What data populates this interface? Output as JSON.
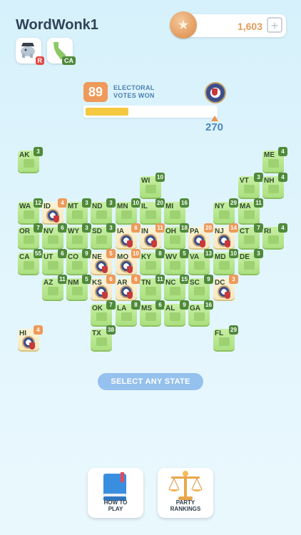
{
  "header": {
    "username": "WordWonk1",
    "coins": "1,603",
    "plus": "+",
    "coin_symbol": "★",
    "badges": [
      {
        "label": "R",
        "color": "#e04a46",
        "icon": "republican-elephant-icon"
      },
      {
        "label": "CA",
        "color": "#4f8a3a",
        "icon": "california-map-icon"
      }
    ]
  },
  "electoral": {
    "votes_won": "89",
    "label_line1": "ELECTORAL",
    "label_line2": "VOTES WON",
    "goal": "270",
    "progress_fraction": 0.33
  },
  "states": [
    {
      "code": "AK",
      "ev": "3",
      "won": false
    },
    {
      "code": "ME",
      "ev": "4",
      "won": false
    },
    {
      "code": "WI",
      "ev": "10",
      "won": false
    },
    {
      "code": "VT",
      "ev": "3",
      "won": false
    },
    {
      "code": "NH",
      "ev": "4",
      "won": false
    },
    {
      "code": "WA",
      "ev": "12",
      "won": false
    },
    {
      "code": "ID",
      "ev": "4",
      "won": true
    },
    {
      "code": "MT",
      "ev": "3",
      "won": false
    },
    {
      "code": "ND",
      "ev": "3",
      "won": false
    },
    {
      "code": "MN",
      "ev": "10",
      "won": false
    },
    {
      "code": "IL",
      "ev": "20",
      "won": false
    },
    {
      "code": "MI",
      "ev": "16",
      "won": false
    },
    {
      "code": "NY",
      "ev": "29",
      "won": false
    },
    {
      "code": "MA",
      "ev": "11",
      "won": false
    },
    {
      "code": "OR",
      "ev": "7",
      "won": false
    },
    {
      "code": "NV",
      "ev": "6",
      "won": false
    },
    {
      "code": "WY",
      "ev": "3",
      "won": false
    },
    {
      "code": "SD",
      "ev": "3",
      "won": false
    },
    {
      "code": "IA",
      "ev": "6",
      "won": true
    },
    {
      "code": "IN",
      "ev": "11",
      "won": true
    },
    {
      "code": "OH",
      "ev": "18",
      "won": false
    },
    {
      "code": "PA",
      "ev": "20",
      "won": true
    },
    {
      "code": "NJ",
      "ev": "14",
      "won": true
    },
    {
      "code": "CT",
      "ev": "7",
      "won": false
    },
    {
      "code": "RI",
      "ev": "4",
      "won": false
    },
    {
      "code": "CA",
      "ev": "55",
      "won": false
    },
    {
      "code": "UT",
      "ev": "6",
      "won": false
    },
    {
      "code": "CO",
      "ev": "9",
      "won": false
    },
    {
      "code": "NE",
      "ev": "5",
      "won": true
    },
    {
      "code": "MO",
      "ev": "10",
      "won": true
    },
    {
      "code": "KY",
      "ev": "8",
      "won": false
    },
    {
      "code": "WV",
      "ev": "5",
      "won": false
    },
    {
      "code": "VA",
      "ev": "13",
      "won": false
    },
    {
      "code": "MD",
      "ev": "10",
      "won": false
    },
    {
      "code": "DE",
      "ev": "3",
      "won": false
    },
    {
      "code": "AZ",
      "ev": "11",
      "won": false
    },
    {
      "code": "NM",
      "ev": "5",
      "won": false
    },
    {
      "code": "KS",
      "ev": "6",
      "won": true
    },
    {
      "code": "AR",
      "ev": "6",
      "won": true
    },
    {
      "code": "TN",
      "ev": "11",
      "won": false
    },
    {
      "code": "NC",
      "ev": "15",
      "won": false
    },
    {
      "code": "SC",
      "ev": "9",
      "won": false
    },
    {
      "code": "DC",
      "ev": "3",
      "won": true
    },
    {
      "code": "OK",
      "ev": "7",
      "won": false
    },
    {
      "code": "LA",
      "ev": "8",
      "won": false
    },
    {
      "code": "MS",
      "ev": "6",
      "won": false
    },
    {
      "code": "AL",
      "ev": "9",
      "won": false
    },
    {
      "code": "GA",
      "ev": "16",
      "won": false
    },
    {
      "code": "HI",
      "ev": "4",
      "won": true
    },
    {
      "code": "TX",
      "ev": "38",
      "won": false
    },
    {
      "code": "FL",
      "ev": "29",
      "won": false
    }
  ],
  "actions": {
    "select_state": "SELECT ANY STATE",
    "how_to_play_line1": "HOW TO",
    "how_to_play_line2": "PLAY",
    "party_rankings_line1": "PARTY",
    "party_rankings_line2": "RANKINGS"
  },
  "colors": {
    "state_green": "#abe07f",
    "won_tile": "#f7e7bd",
    "won_badge": "#ed9a5a",
    "ev_badge": "#4f8a3a",
    "accent_blue": "#95c1ef",
    "progress_yellow": "#f4c83f"
  }
}
